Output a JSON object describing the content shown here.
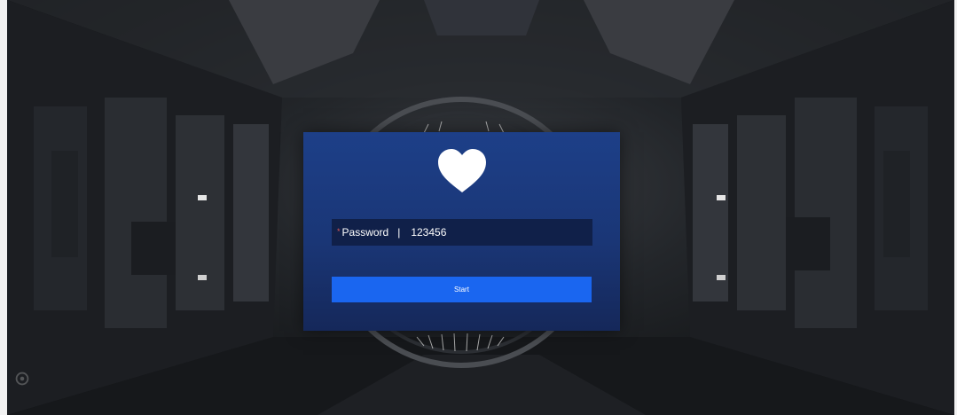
{
  "login": {
    "password_label": "Password",
    "required_mark": "*",
    "separator": "|",
    "password_value": "123456",
    "start_label": "Start"
  },
  "icons": {
    "logo": "heart-icon",
    "corner": "gear-icon"
  },
  "colors": {
    "panel": "#1d3f88",
    "button": "#1a66f0",
    "input_bg": "#102049"
  }
}
